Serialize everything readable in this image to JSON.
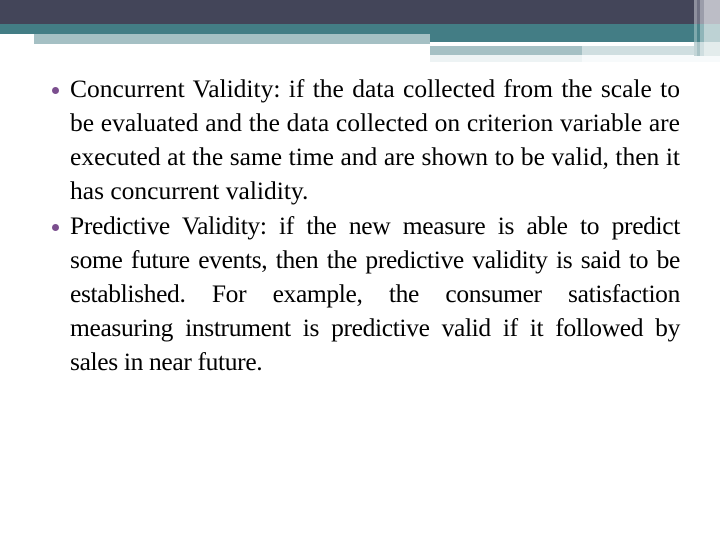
{
  "slide": {
    "theme": {
      "header_dark": "#434559",
      "header_teal": "#437d85",
      "header_pale": "#a5c0c4",
      "header_faint": "#edf3f4",
      "bullet_color": "#7b4e8e",
      "text_color": "#000000",
      "background": "#ffffff"
    },
    "bullets": [
      {
        "text": "Concurrent Validity: if the data collected from the scale to be evaluated and the data collected on criterion variable are executed at the same time and are shown to be valid, then it has concurrent validity."
      },
      {
        "text": "Predictive Validity: if the new measure is able to predict some future events, then the predictive validity is said to be established. For example, the consumer satisfaction measuring instrument is predictive valid if it followed by sales in near future."
      }
    ]
  }
}
